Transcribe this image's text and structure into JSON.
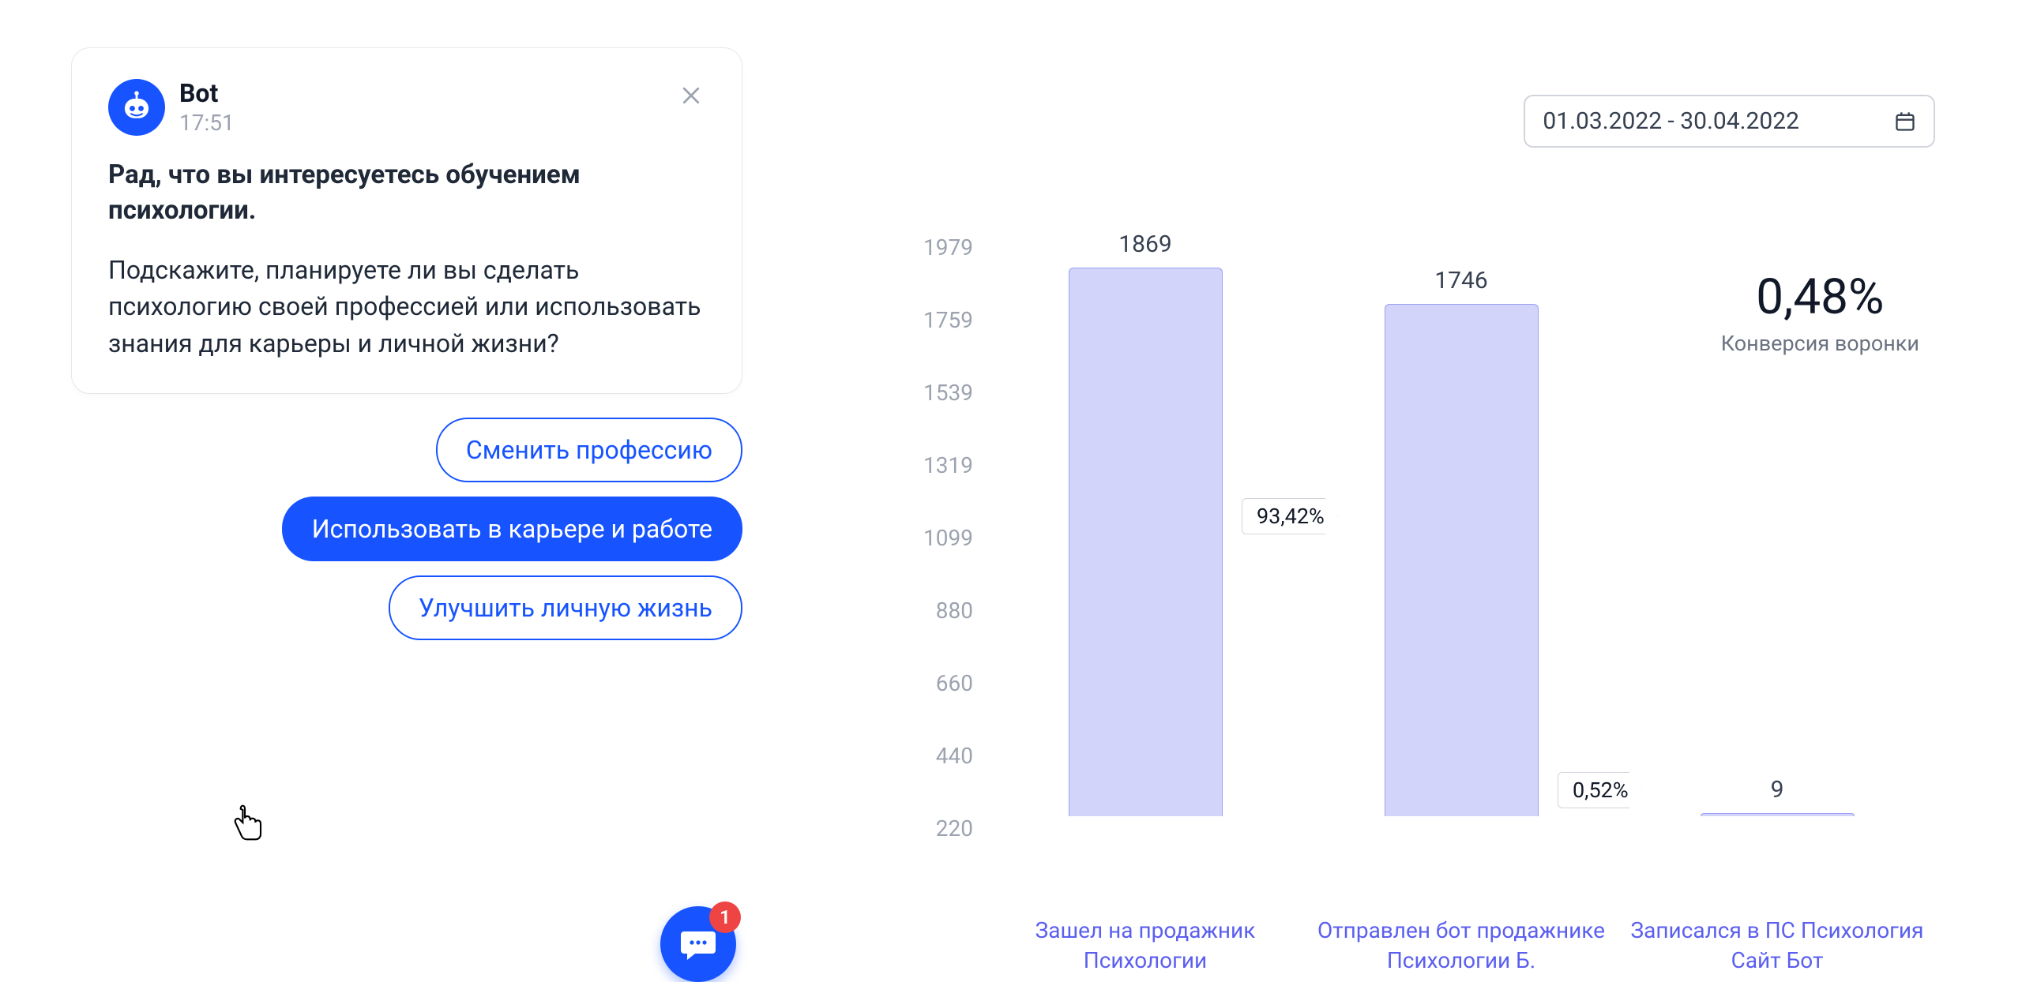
{
  "chat": {
    "sender": "Bot",
    "time": "17:51",
    "greeting": "Рад, что вы интересуетесь обучением психологии.",
    "question": "Подскажите, планируете ли вы сделать психологию своей профессией или использовать знания для карьеры и личной жизни?",
    "replies": [
      {
        "label": "Сменить профессию",
        "selected": false
      },
      {
        "label": "Использовать в карьере и работе",
        "selected": true
      },
      {
        "label": "Улучшить личную жизнь",
        "selected": false
      }
    ],
    "fab_badge": "1"
  },
  "analytics": {
    "date_range": "01.03.2022 - 30.04.2022",
    "conversion_value": "0,48%",
    "conversion_label": "Конверсия воронки",
    "transitions": [
      "93,42%",
      "0,52%"
    ]
  },
  "chart_data": {
    "type": "bar",
    "categories": [
      "Зашел на продажник Психологии",
      "Отправлен бот продажнике Психологии Б.",
      "Записался в ПС Психология Сайт Бот"
    ],
    "values": [
      1869,
      1746,
      9
    ],
    "y_ticks": [
      1979,
      1759,
      1539,
      1319,
      1099,
      880,
      660,
      440,
      220
    ],
    "ylim": [
      0,
      1979
    ],
    "title": "",
    "xlabel": "",
    "ylabel": ""
  }
}
